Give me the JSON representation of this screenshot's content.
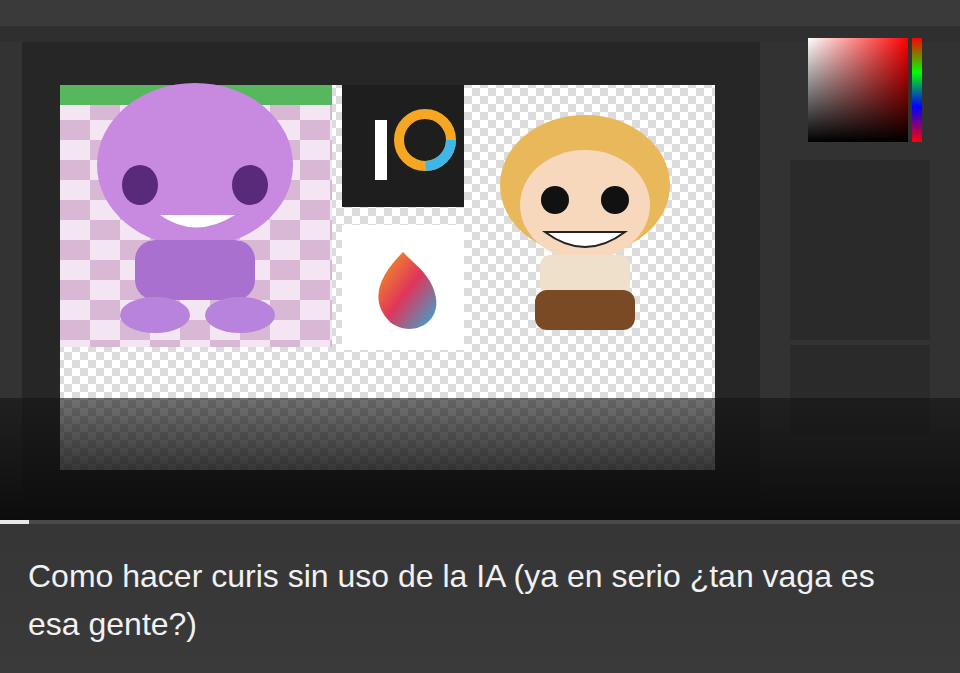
{
  "video": {
    "title": "Como hacer curis sin uso de la IA (ya en serio ¿tan vaga es esa gente?)",
    "progress": 0.03
  }
}
